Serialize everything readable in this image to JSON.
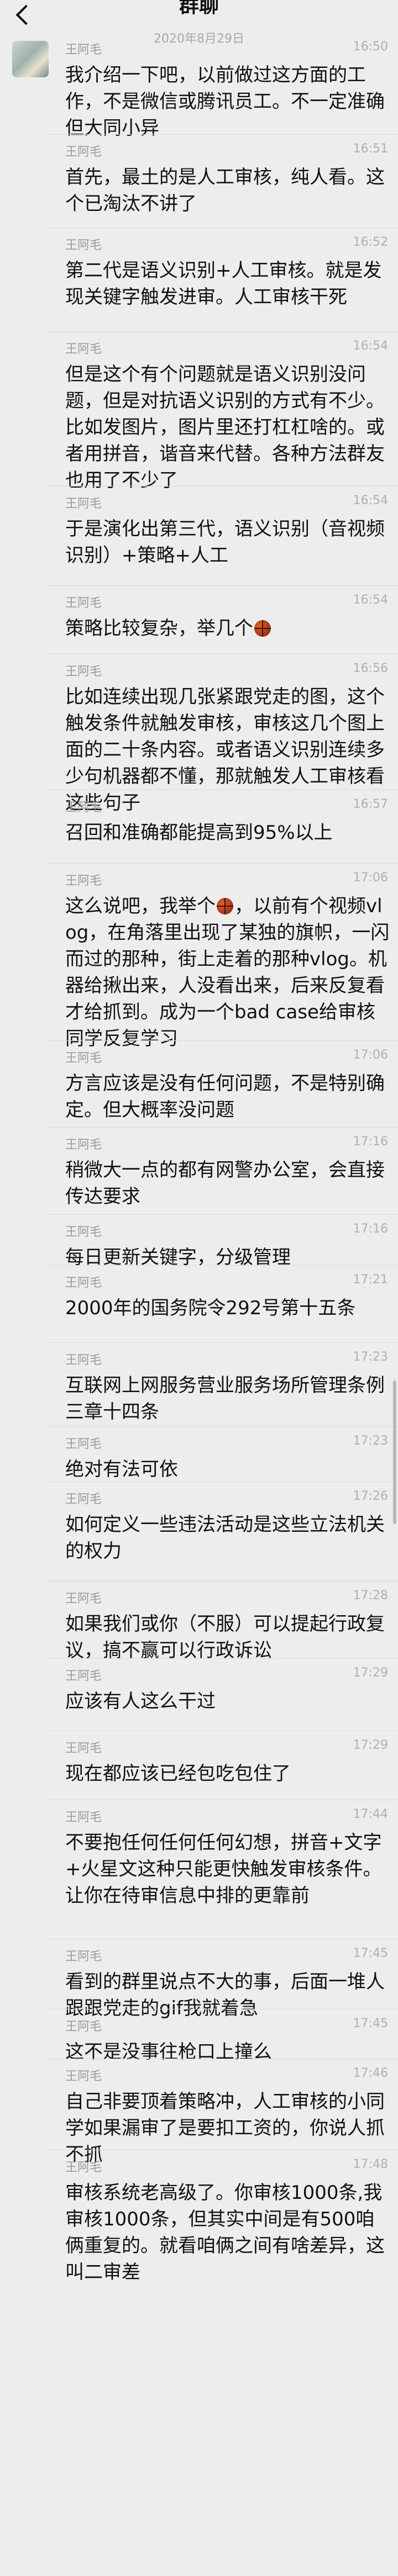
{
  "header": {
    "title": "群聊",
    "back_icon": "chevron-left-icon"
  },
  "date_divider": "2020年8月29日",
  "sender_name": "王阿毛",
  "messages": [
    {
      "time": "16:50",
      "show_avatar": true,
      "text": "我介绍一下吧，以前做过这方面的工作，不是微信或腾讯员工。不一定准确但大同小异"
    },
    {
      "time": "16:51",
      "text": "首先，最土的是人工审核，纯人看。这个已淘汰不讲了"
    },
    {
      "time": "16:52",
      "text": "第二代是语义识别+人工审核。就是发现关键字触发进审。人工审核干死"
    },
    {
      "time": "16:54",
      "text": "但是这个有个问题就是语义识别没问题，但是对抗语义识别的方式有不少。比如发图片，图片里还打杠杠啥的。或者用拼音，谐音来代替。各种方法群友也用了不少了"
    },
    {
      "time": "16:54",
      "text": "于是演化出第三代，语义识别（音视频识别）+策略+人工"
    },
    {
      "time": "16:54",
      "text": "策略比较复杂，举几个",
      "ball_after": true
    },
    {
      "time": "16:56",
      "text": "比如连续出现几张紧跟党走的图，这个触发条件就触发审核，审核这几个图上面的二十条内容。或者语义识别连续多少句机器都不懂，那就触发人工审核看这些句子"
    },
    {
      "time": "16:57",
      "text": "召回和准确都能提高到95%以上"
    },
    {
      "time": "17:06",
      "text_before_ball": "这么说吧，我举个",
      "text_after_ball": "，以前有个视频vlog，在角落里出现了某独的旗帜，一闪而过的那种，街上走着的那种vlog。机器给揪出来，人没看出来，后来反复看才给抓到。成为一个bad case给审核同学反复学习"
    },
    {
      "time": "17:06",
      "text": "方言应该是没有任何问题，不是特别确定。但大概率没问题"
    },
    {
      "time": "17:16",
      "text": "稍微大一点的都有网警办公室，会直接传达要求"
    },
    {
      "time": "17:16",
      "text": "每日更新关键字，分级管理"
    },
    {
      "time": "17:21",
      "text": "2000年的国务院令292号第十五条"
    },
    {
      "time": "17:23",
      "text": "互联网上网服务营业服务场所管理条例三章十四条"
    },
    {
      "time": "17:23",
      "text": "绝对有法可依"
    },
    {
      "time": "17:26",
      "text": "如何定义一些违法活动是这些立法机关的权力"
    },
    {
      "time": "17:28",
      "text": "如果我们或你（不服）可以提起行政复议，搞不赢可以行政诉讼"
    },
    {
      "time": "17:29",
      "text": "应该有人这么干过"
    },
    {
      "time": "17:29",
      "text": "现在都应该已经包吃包住了"
    },
    {
      "time": "17:44",
      "text": "不要抱任何任何任何幻想，拼音+文字+火星文这种只能更快触发审核条件。让你在待审信息中排的更靠前"
    },
    {
      "time": "17:45",
      "text": "看到的群里说点不大的事，后面一堆人跟跟党走的gif我就着急"
    },
    {
      "time": "17:45",
      "text": "这不是没事往枪口上撞么"
    },
    {
      "time": "17:46",
      "text": "自己非要顶着策略冲，人工审核的小同学如果漏审了是要扣工资的，你说人抓不抓"
    },
    {
      "time": "17:48",
      "text": "审核系统老高级了。你审核1000条,我审核1000条，但其实中间是有500咱俩重复的。就看咱俩之间有啥差异，这叫二审差"
    }
  ]
}
